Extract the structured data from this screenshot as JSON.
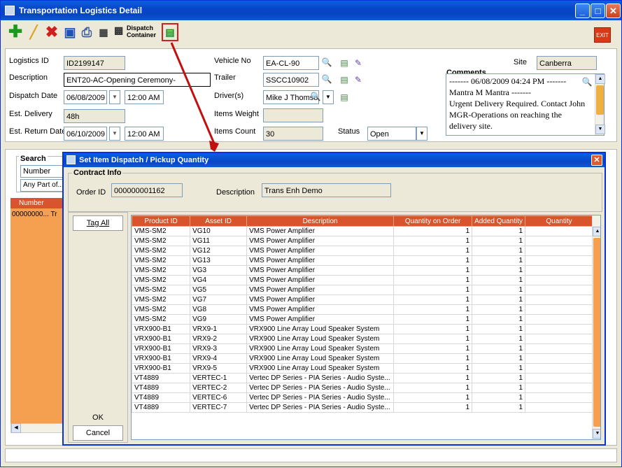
{
  "window": {
    "title": "Transportation Logistics Detail"
  },
  "toolbar": {
    "dispatch_label_1": "Dispatch",
    "dispatch_label_2": "Container",
    "exit_label": "EXIT"
  },
  "form": {
    "logistics_id_label": "Logistics ID",
    "logistics_id": "ID2199147",
    "description_label": "Description",
    "description": "ENT20-AC-Opening Ceremony-",
    "dispatch_date_label": "Dispatch Date",
    "dispatch_date": "06/08/2009",
    "dispatch_time": "12:00 AM",
    "est_delivery_label": "Est. Delivery",
    "est_delivery": "48h",
    "est_return_label": "Est. Return Date",
    "est_return_date": "06/10/2009",
    "est_return_time": "12:00 AM",
    "vehicle_label": "Vehicle No",
    "vehicle": "EA-CL-90",
    "trailer_label": "Trailer",
    "trailer": "SSCC10902",
    "drivers_label": "Driver(s)",
    "drivers": "Mike J Thomson",
    "items_weight_label": "Items Weight",
    "items_weight": "",
    "items_count_label": "Items Count",
    "items_count": "30",
    "status_label": "Status",
    "status": "Open",
    "site_label": "Site",
    "site": "Canberra",
    "comments_label": "Comments",
    "comments_lines": [
      "------- 06/08/2009 04:24 PM -------",
      "Mantra M Mantra -------",
      "Urgent Delivery Required. Contact John",
      "MGR-Operations on reaching the",
      "delivery site."
    ]
  },
  "search": {
    "title": "Search",
    "field": "Number",
    "mode": "Any Part of...",
    "col_number": "Number",
    "row1": "00000000...",
    "row1_b": "Tr"
  },
  "dialog": {
    "title": "Set Item Dispatch / Pickup Quantity",
    "contract_info": "Contract Info",
    "order_id_label": "Order ID",
    "order_id": "000000001162",
    "description_label": "Description",
    "description": "Trans Enh Demo",
    "tag_all": "Tag All",
    "ok": "OK",
    "cancel": "Cancel",
    "columns": [
      "Product ID",
      "Asset ID",
      "Description",
      "Quantity on Order",
      "Added Quantity",
      "Quantity"
    ],
    "rows": [
      [
        "VMS-SM2",
        "VG10",
        "VMS Power Amplifier",
        "1",
        "1",
        ""
      ],
      [
        "VMS-SM2",
        "VG11",
        "VMS Power Amplifier",
        "1",
        "1",
        ""
      ],
      [
        "VMS-SM2",
        "VG12",
        "VMS Power Amplifier",
        "1",
        "1",
        ""
      ],
      [
        "VMS-SM2",
        "VG13",
        "VMS Power Amplifier",
        "1",
        "1",
        ""
      ],
      [
        "VMS-SM2",
        "VG3",
        "VMS Power Amplifier",
        "1",
        "1",
        ""
      ],
      [
        "VMS-SM2",
        "VG4",
        "VMS Power Amplifier",
        "1",
        "1",
        ""
      ],
      [
        "VMS-SM2",
        "VG5",
        "VMS Power Amplifier",
        "1",
        "1",
        ""
      ],
      [
        "VMS-SM2",
        "VG7",
        "VMS Power Amplifier",
        "1",
        "1",
        ""
      ],
      [
        "VMS-SM2",
        "VG8",
        "VMS Power Amplifier",
        "1",
        "1",
        ""
      ],
      [
        "VMS-SM2",
        "VG9",
        "VMS Power Amplifier",
        "1",
        "1",
        ""
      ],
      [
        "VRX900-B1",
        "VRX9-1",
        "VRX900  Line Array Loud Speaker System",
        "1",
        "1",
        ""
      ],
      [
        "VRX900-B1",
        "VRX9-2",
        "VRX900  Line Array Loud Speaker System",
        "1",
        "1",
        ""
      ],
      [
        "VRX900-B1",
        "VRX9-3",
        "VRX900  Line Array Loud Speaker System",
        "1",
        "1",
        ""
      ],
      [
        "VRX900-B1",
        "VRX9-4",
        "VRX900  Line Array Loud Speaker System",
        "1",
        "1",
        ""
      ],
      [
        "VRX900-B1",
        "VRX9-5",
        "VRX900  Line Array Loud Speaker System",
        "1",
        "1",
        ""
      ],
      [
        "VT4889",
        "VERTEC-1",
        "Vertec DP Series - PIA Series - Audio Syste...",
        "1",
        "1",
        ""
      ],
      [
        "VT4889",
        "VERTEC-2",
        "Vertec DP Series - PIA Series - Audio Syste...",
        "1",
        "1",
        ""
      ],
      [
        "VT4889",
        "VERTEC-6",
        "Vertec DP Series - PIA Series - Audio Syste...",
        "1",
        "1",
        ""
      ],
      [
        "VT4889",
        "VERTEC-7",
        "Vertec DP Series - PIA Series - Audio Syste...",
        "1",
        "1",
        ""
      ]
    ]
  }
}
